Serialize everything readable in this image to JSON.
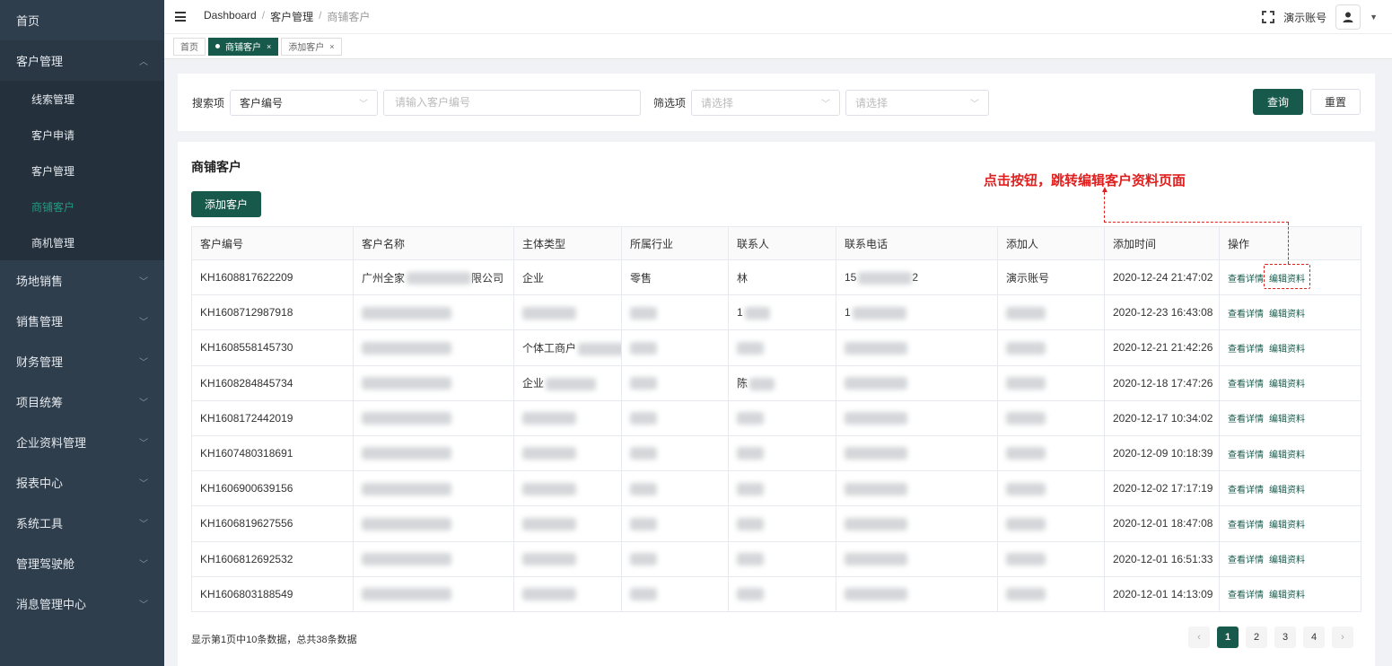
{
  "sidebar": {
    "top_item": "首页",
    "group_open": "客户管理",
    "sub_items": [
      "线索管理",
      "客户申请",
      "客户管理",
      "商铺客户",
      "商机管理"
    ],
    "groups": [
      "场地销售",
      "销售管理",
      "财务管理",
      "项目统筹",
      "企业资料管理",
      "报表中心",
      "系统工具",
      "管理驾驶舱",
      "消息管理中心"
    ]
  },
  "header": {
    "breadcrumb": [
      "Dashboard",
      "客户管理",
      "商铺客户"
    ],
    "account_name": "演示账号"
  },
  "tabs": [
    {
      "label": "首页"
    },
    {
      "label": "商铺客户"
    },
    {
      "label": "添加客户"
    }
  ],
  "search": {
    "search_label": "搜索项",
    "search_field": "客户编号",
    "search_placeholder": "请输入客户编号",
    "filter_label": "筛选项",
    "filter1_placeholder": "请选择",
    "filter2_placeholder": "请选择",
    "query_button": "查询",
    "reset_button": "重置"
  },
  "main": {
    "title": "商铺客户",
    "add_button": "添加客户",
    "annotation": "点击按钮，跳转编辑客户资料页面"
  },
  "table": {
    "headers": [
      "客户编号",
      "客户名称",
      "主体类型",
      "所属行业",
      "联系人",
      "联系电话",
      "添加人",
      "添加时间",
      "操作"
    ],
    "rows": [
      {
        "id": "KH1608817622209",
        "name": "广州全家",
        "name_tail": "限公司",
        "type": "企业",
        "industry": "零售",
        "contact": "林",
        "phone": "15",
        "phone_tail": "2",
        "adder": "演示账号",
        "time": "2020-12-24 21:47:02"
      },
      {
        "id": "KH1608712987918",
        "name": "",
        "name_tail": "",
        "type": "",
        "industry": "",
        "contact": "1",
        "phone": "1",
        "phone_tail": "",
        "adder": "",
        "time": "2020-12-23 16:43:08"
      },
      {
        "id": "KH1608558145730",
        "name": "",
        "name_tail": "",
        "type": "个体工商户",
        "industry": "",
        "contact": "",
        "phone": "",
        "phone_tail": "",
        "adder": "",
        "time": "2020-12-21 21:42:26"
      },
      {
        "id": "KH1608284845734",
        "name": "",
        "name_tail": "",
        "type": "企业",
        "industry": "",
        "contact": "陈",
        "phone": "",
        "phone_tail": "",
        "adder": "",
        "time": "2020-12-18 17:47:26"
      },
      {
        "id": "KH1608172442019",
        "name": "",
        "name_tail": "",
        "type": "",
        "industry": "",
        "contact": "",
        "phone": "",
        "phone_tail": "",
        "adder": "",
        "time": "2020-12-17 10:34:02"
      },
      {
        "id": "KH1607480318691",
        "name": "",
        "name_tail": "",
        "type": "",
        "industry": "",
        "contact": "",
        "phone": "",
        "phone_tail": "",
        "adder": "",
        "time": "2020-12-09 10:18:39"
      },
      {
        "id": "KH1606900639156",
        "name": "",
        "name_tail": "",
        "type": "",
        "industry": "",
        "contact": "",
        "phone": "",
        "phone_tail": "",
        "adder": "",
        "time": "2020-12-02 17:17:19"
      },
      {
        "id": "KH1606819627556",
        "name": "",
        "name_tail": "",
        "type": "",
        "industry": "",
        "contact": "",
        "phone": "",
        "phone_tail": "",
        "adder": "",
        "time": "2020-12-01 18:47:08"
      },
      {
        "id": "KH1606812692532",
        "name": "",
        "name_tail": "",
        "type": "",
        "industry": "",
        "contact": "",
        "phone": "",
        "phone_tail": "",
        "adder": "",
        "time": "2020-12-01 16:51:33"
      },
      {
        "id": "KH1606803188549",
        "name": "",
        "name_tail": "",
        "type": "",
        "industry": "",
        "contact": "",
        "phone": "",
        "phone_tail": "",
        "adder": "",
        "time": "2020-12-01 14:13:09"
      }
    ],
    "op_view": "查看详情",
    "op_edit": "编辑资料"
  },
  "footer": {
    "info": "显示第1页中10条数据，总共38条数据",
    "pages": [
      "1",
      "2",
      "3",
      "4"
    ],
    "current_page": "1"
  },
  "colors": {
    "primary": "#17594a",
    "sidebar_bg": "#2f3e4d",
    "active_menu": "#1f9d7f",
    "annotation": "#e0201f"
  }
}
